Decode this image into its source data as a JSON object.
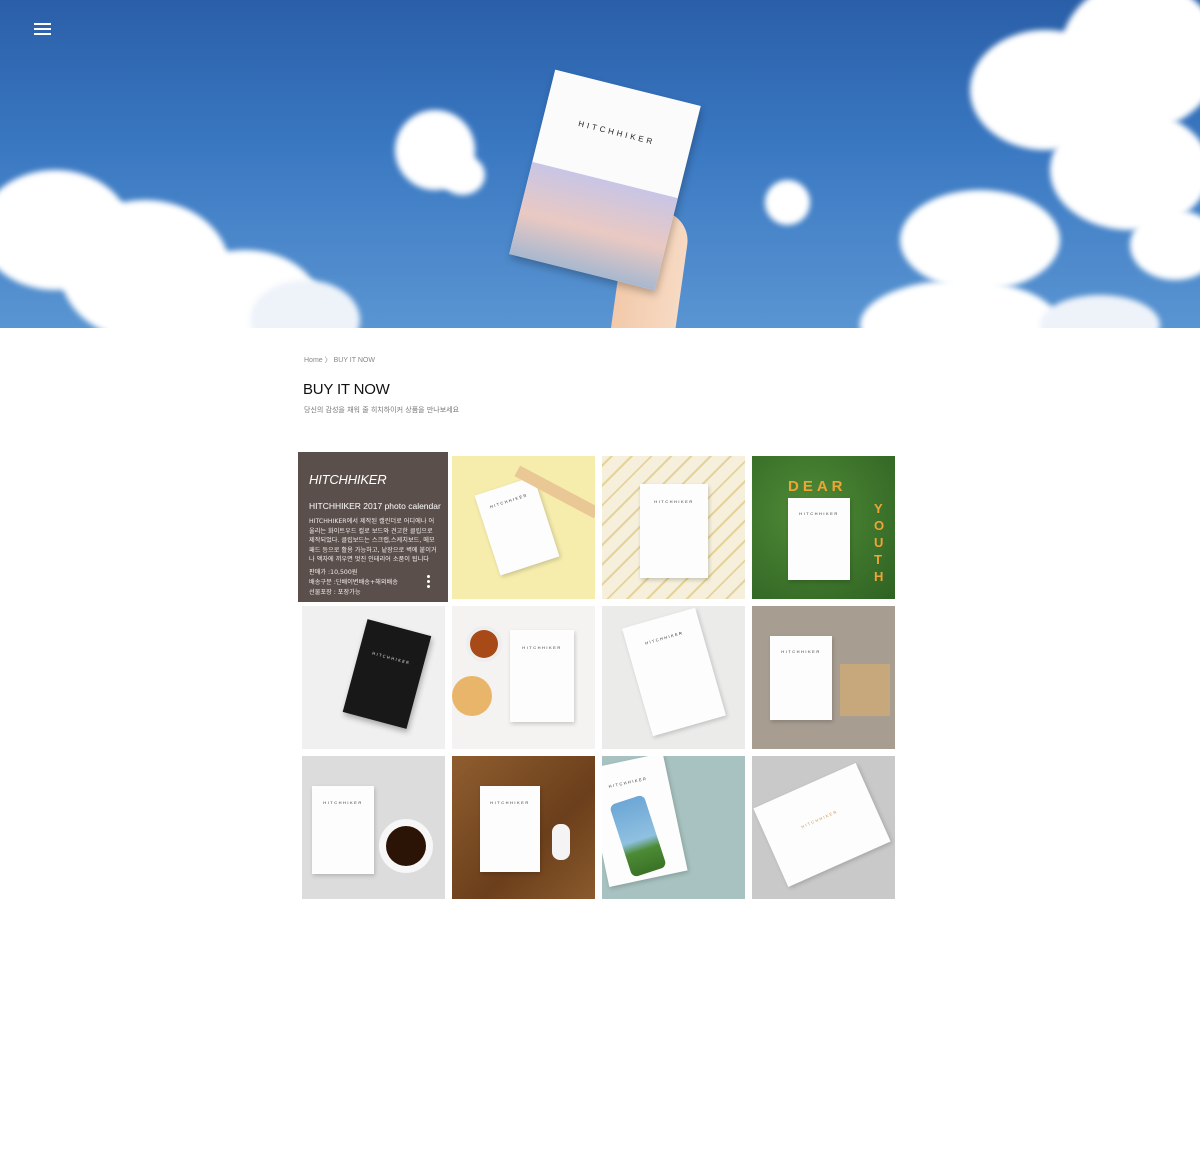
{
  "nav": {
    "menu_icon": "hamburger-menu-icon"
  },
  "hero": {
    "book_title": "HITCHHIKER"
  },
  "breadcrumb": {
    "home": "Home",
    "separator": "〉",
    "current": "BUY IT NOW"
  },
  "page": {
    "title": "BUY IT NOW",
    "subtitle": "당신의 감성을 채워 줄 히치하이커 상품을 만나보세요"
  },
  "featured": {
    "brand": "HITCHHIKER",
    "product_name": "HITCHHIKER 2017 photo calendar",
    "description": "HITCHHIKER에서 제작된 캘린더로 어디에나 어울리는 화이트우드 컬로 보드와 견고한 클립으로 제작되었다. 클립보드는 스크랩,스케치보드, 메모 패드 등으로 활용 가능하고, 낱장으로 벽에 붙이거나 액자에 끼우면 멋진 인테리어 소품이 됩니다",
    "price": "판매가 :10,500원",
    "shipping": "배송구분 :단배이변배송+해외배송",
    "gift_wrap": "선물포장 : 포장가능",
    "more_icon": "vertical-dots-icon"
  },
  "products": [
    {
      "label": "HITCHHIKER"
    },
    {
      "label": "HITCHHIKER"
    },
    {
      "label": "HITCHHIKER"
    },
    {
      "label": "HITCHHIKER"
    },
    {
      "label": "HITCHHIKER"
    },
    {
      "label": "HITCHHIKER"
    },
    {
      "label": "HITCHHIKER"
    },
    {
      "label": "HITCHHIKER"
    },
    {
      "label": "HITCHHIKER"
    },
    {
      "label": "HITCHHIKER"
    },
    {
      "label": "HITCHHIKER"
    }
  ],
  "colors": {
    "sky": "#3a78c2",
    "featured_overlay": "#5a4f4b",
    "grass": "#3f7a2c",
    "letters": "#f0a437"
  },
  "decor": {
    "dear": "DEAR",
    "youth": "YOUTH"
  }
}
